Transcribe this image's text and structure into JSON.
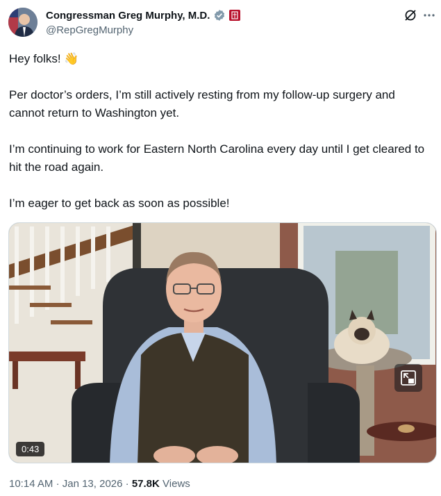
{
  "author": {
    "name": "Congressman Greg Murphy, M.D.",
    "handle": "@RepGregMurphy"
  },
  "tweet": {
    "line1": "Hey folks! 👋",
    "line2": "Per doctor’s orders, I’m still actively resting from my follow-up surgery and cannot return to Washington yet.",
    "line3": "I’m continuing to work for Eastern North Carolina every day until I get cleared to hit the road again.",
    "line4": "I’m eager to get back as soon as possible!"
  },
  "video": {
    "duration": "0:43"
  },
  "meta": {
    "time": "10:14 AM",
    "date": "Jan 13, 2026",
    "views_count": "57.8K",
    "views_label": "Views"
  },
  "icons": {
    "verified": "gray-verified-badge",
    "affiliation": "congress-badge",
    "grok": "grok-icon",
    "more": "more-icon",
    "pip": "picture-in-picture-icon"
  },
  "colors": {
    "text": "#0f1419",
    "secondary": "#536471",
    "badge_gray": "#829aab",
    "badge_red": "#b8102b"
  }
}
